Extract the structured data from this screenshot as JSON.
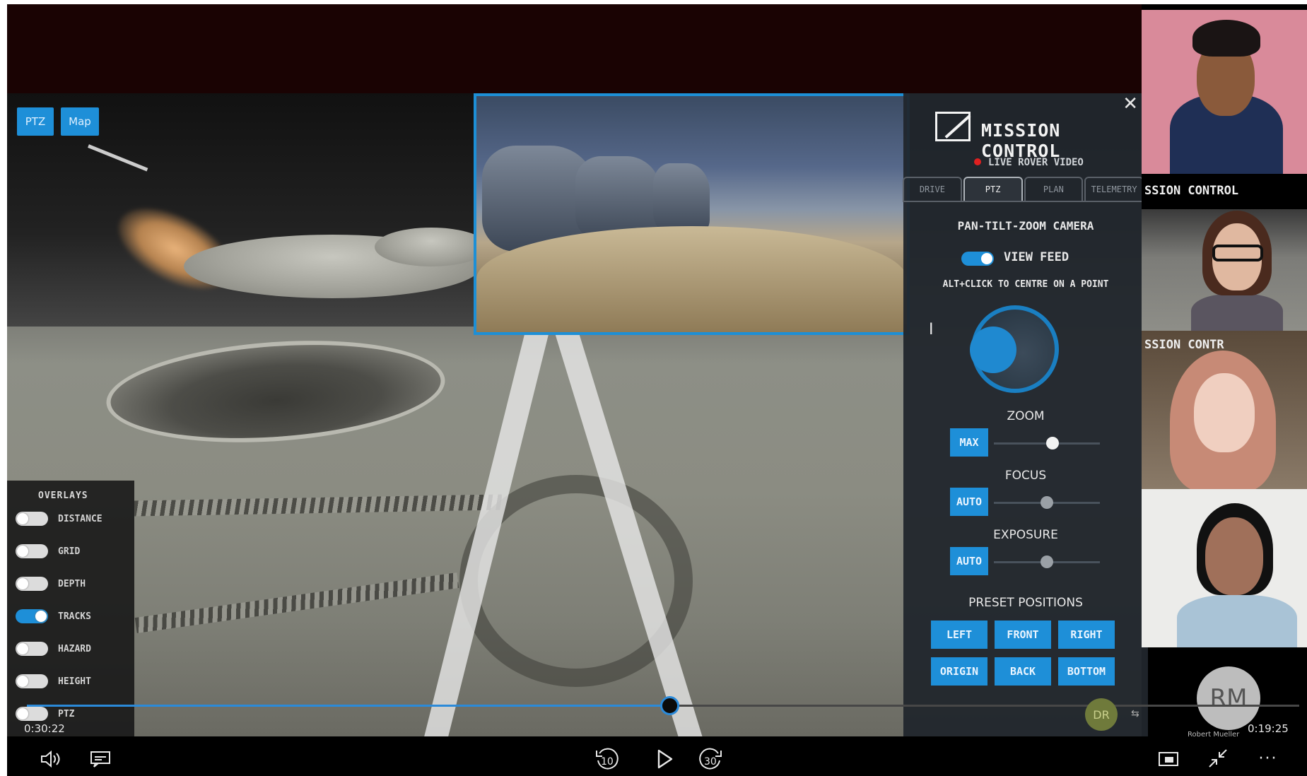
{
  "video_buttons": {
    "ptz": "PTZ",
    "map": "Map"
  },
  "panel": {
    "title": "MISSION CONTROL",
    "live": "LIVE ROVER VIDEO",
    "tabs": [
      "DRIVE",
      "PTZ",
      "PLAN",
      "TELEMETRY"
    ],
    "active_tab": "PTZ",
    "camera_heading": "PAN-TILT-ZOOM CAMERA",
    "view_feed": "VIEW FEED",
    "hint": "ALT+CLICK TO CENTRE ON A POINT",
    "zoom": {
      "label": "ZOOM",
      "button": "MAX",
      "level": 0.55
    },
    "focus": {
      "label": "FOCUS",
      "button": "AUTO",
      "level": 0.5
    },
    "exposure": {
      "label": "EXPOSURE",
      "button": "AUTO",
      "level": 0.5
    },
    "presets_heading": "PRESET POSITIONS",
    "presets": [
      "LEFT",
      "FRONT",
      "RIGHT",
      "ORIGIN",
      "BACK",
      "BOTTOM"
    ]
  },
  "overlays": {
    "title": "OVERLAYS",
    "items": [
      {
        "label": "DISTANCE",
        "on": false
      },
      {
        "label": "GRID",
        "on": false
      },
      {
        "label": "DEPTH",
        "on": false
      },
      {
        "label": "TRACKS",
        "on": true
      },
      {
        "label": "HAZARD",
        "on": false
      },
      {
        "label": "HEIGHT",
        "on": false
      },
      {
        "label": "PTZ",
        "on": false
      }
    ]
  },
  "participants": {
    "tile_label_1": "SSION CONTROL",
    "tile_label_2": "SSION CONTR",
    "presenter_initials": "RM",
    "presenter_name": "Robert Mueller",
    "badge_initials": "DR"
  },
  "player": {
    "elapsed": "0:30:22",
    "remaining": "0:19:25",
    "progress": 0.505,
    "rewind_seconds": "10",
    "forward_seconds": "30",
    "more": "···"
  },
  "colors": {
    "accent": "#1e8fd8",
    "progress": "#2b8ad9",
    "live_dot": "#e02020"
  }
}
